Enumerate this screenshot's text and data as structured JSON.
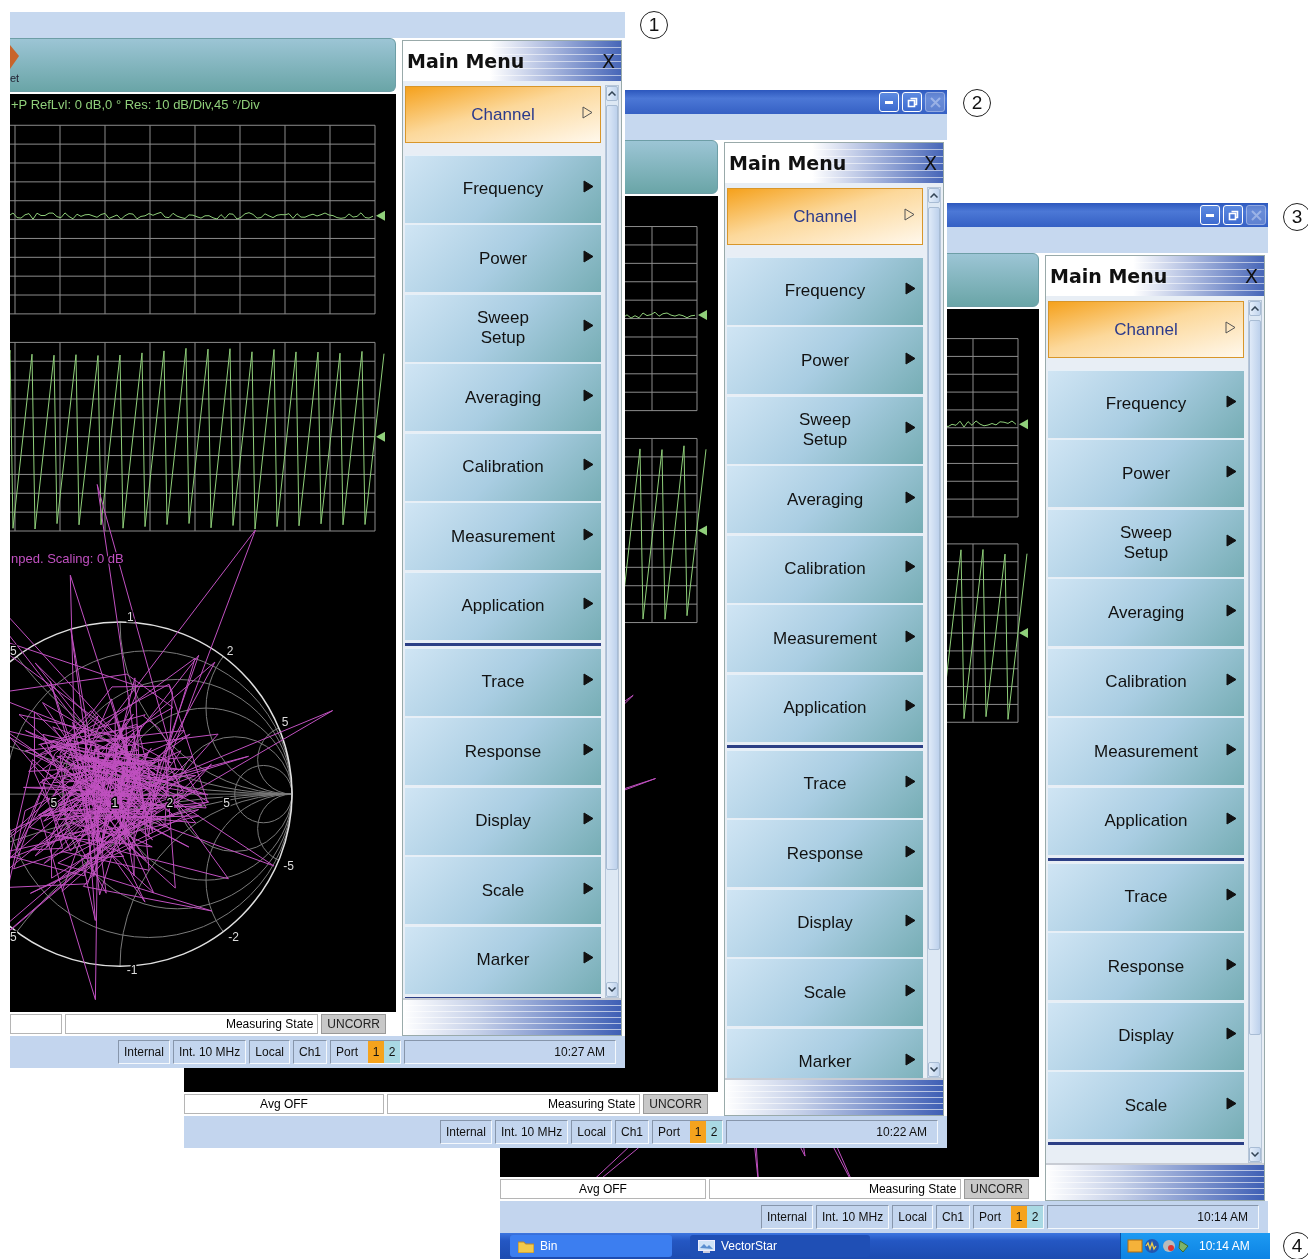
{
  "windows": [
    {
      "toolbar": {
        "label": "et"
      },
      "plot": {
        "trace_label": "+P RefLvl: 0  dB,0 ° Res: 10  dB/Div,45 °/Div",
        "smith_label": "nped.  Scaling: 0 dB",
        "smith_labels": [
          "1",
          "2",
          "5",
          "-5",
          "-2",
          "-1",
          "5",
          "5",
          "5",
          "1",
          "2",
          "5"
        ]
      },
      "main_menu": {
        "title": "Main Menu",
        "close": "X",
        "groups": [
          [
            {
              "label": "Channel",
              "selected": true
            },
            {
              "label": "Frequency",
              "selected": false
            },
            {
              "label": "Power",
              "selected": false
            },
            {
              "label": "Sweep\nSetup",
              "selected": false
            },
            {
              "label": "Averaging",
              "selected": false
            },
            {
              "label": "Calibration",
              "selected": false
            },
            {
              "label": "Measurement",
              "selected": false
            },
            {
              "label": "Application",
              "selected": false
            }
          ],
          [
            {
              "label": "Trace",
              "selected": false
            },
            {
              "label": "Response",
              "selected": false
            },
            {
              "label": "Display",
              "selected": false
            },
            {
              "label": "Scale",
              "selected": false
            },
            {
              "label": "Marker",
              "selected": false
            }
          ]
        ]
      },
      "status": {
        "measuring_state": "Measuring State",
        "correction": "UNCORR"
      },
      "bottom_bar": {
        "cells": [
          "Internal",
          "Int. 10 MHz",
          "Local",
          "Ch1"
        ],
        "port_label": "Port",
        "ports": [
          {
            "label": "1",
            "selected": true
          },
          {
            "label": "2",
            "selected": false
          }
        ],
        "time": "10:27 AM"
      }
    },
    {
      "title_bar": {
        "buttons": [
          {
            "kind": "minimize",
            "disabled": false
          },
          {
            "kind": "restore",
            "disabled": false
          },
          {
            "kind": "close",
            "disabled": true
          }
        ]
      },
      "main_menu": {
        "title": "Main Menu",
        "close": "X",
        "groups": [
          [
            {
              "label": "Channel",
              "selected": true
            },
            {
              "label": "Frequency",
              "selected": false
            },
            {
              "label": "Power",
              "selected": false
            },
            {
              "label": "Sweep\nSetup",
              "selected": false
            },
            {
              "label": "Averaging",
              "selected": false
            },
            {
              "label": "Calibration",
              "selected": false
            },
            {
              "label": "Measurement",
              "selected": false
            },
            {
              "label": "Application",
              "selected": false
            }
          ],
          [
            {
              "label": "Trace",
              "selected": false
            },
            {
              "label": "Response",
              "selected": false
            },
            {
              "label": "Display",
              "selected": false
            },
            {
              "label": "Scale",
              "selected": false
            },
            {
              "label": "Marker",
              "selected": false
            }
          ]
        ]
      },
      "status": {
        "avg": "Avg OFF",
        "measuring_state": "Measuring State",
        "correction": "UNCORR"
      },
      "bottom_bar": {
        "cells": [
          "Internal",
          "Int. 10 MHz",
          "Local",
          "Ch1"
        ],
        "port_label": "Port",
        "ports": [
          {
            "label": "1",
            "selected": true
          },
          {
            "label": "2",
            "selected": false
          }
        ],
        "time": "10:22 AM"
      }
    },
    {
      "title_bar": {
        "buttons": [
          {
            "kind": "minimize",
            "disabled": false
          },
          {
            "kind": "restore",
            "disabled": false
          },
          {
            "kind": "close",
            "disabled": true
          }
        ]
      },
      "main_menu": {
        "title": "Main Menu",
        "close": "X",
        "groups": [
          [
            {
              "label": "Channel",
              "selected": true
            },
            {
              "label": "Frequency",
              "selected": false
            },
            {
              "label": "Power",
              "selected": false
            },
            {
              "label": "Sweep\nSetup",
              "selected": false
            },
            {
              "label": "Averaging",
              "selected": false
            },
            {
              "label": "Calibration",
              "selected": false
            },
            {
              "label": "Measurement",
              "selected": false
            },
            {
              "label": "Application",
              "selected": false
            }
          ],
          [
            {
              "label": "Trace",
              "selected": false
            },
            {
              "label": "Response",
              "selected": false
            },
            {
              "label": "Display",
              "selected": false
            },
            {
              "label": "Scale",
              "selected": false
            }
          ]
        ]
      },
      "status": {
        "avg": "Avg OFF",
        "measuring_state": "Measuring State",
        "correction": "UNCORR"
      },
      "bottom_bar": {
        "cells": [
          "Internal",
          "Int. 10 MHz",
          "Local",
          "Ch1"
        ],
        "port_label": "Port",
        "ports": [
          {
            "label": "1",
            "selected": true
          },
          {
            "label": "2",
            "selected": false
          }
        ],
        "time": "10:14 AM"
      }
    }
  ],
  "taskbar": {
    "buttons": [
      {
        "label": "Bin",
        "selected": false
      },
      {
        "label": "VectorStar",
        "selected": true
      }
    ],
    "clock": "10:14 AM"
  },
  "callouts": [
    "1",
    "2",
    "3",
    "4"
  ]
}
